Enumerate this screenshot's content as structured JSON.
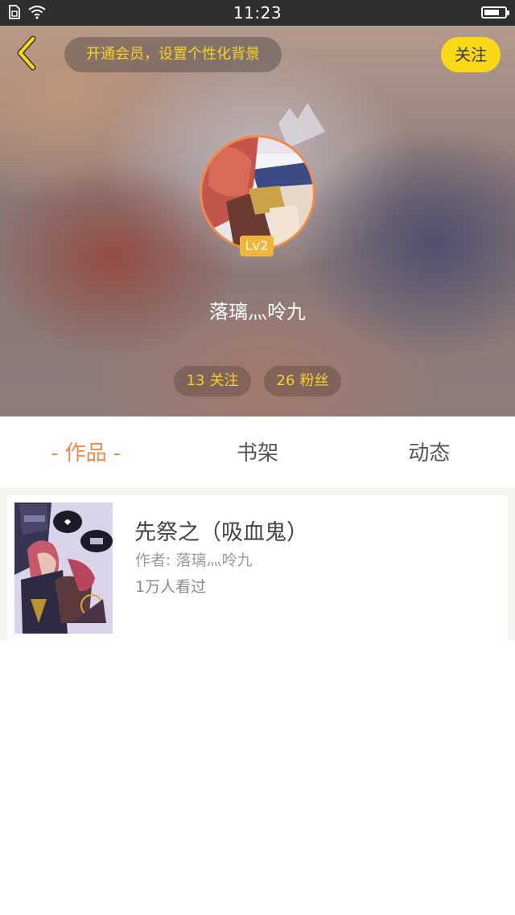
{
  "status_bar": {
    "time": "11:23",
    "battery_level": 0.75
  },
  "header": {
    "vip_banner": "开通会员，设置个性化背景",
    "follow_label": "关注",
    "level": "Lv2",
    "username": "落璃灬呤九",
    "following_count": "13",
    "following_label": "关注",
    "fans_count": "26",
    "fans_label": "粉丝"
  },
  "tabs": [
    {
      "label": "作品",
      "active": true
    },
    {
      "label": "书架",
      "active": false
    },
    {
      "label": "动态",
      "active": false
    }
  ],
  "works": [
    {
      "title": "先祭之（吸血鬼）",
      "author": "作者: 落璃灬呤九",
      "views": "1万人看过"
    }
  ],
  "colors": {
    "accent": "#f08a4a",
    "yellow": "#f8d817",
    "banner_text": "#f5d327"
  },
  "icons": {
    "back": "chevron-left-icon",
    "crown": "crown-icon",
    "wifi": "wifi-icon",
    "sim": "sim-card-icon",
    "battery": "battery-icon"
  }
}
